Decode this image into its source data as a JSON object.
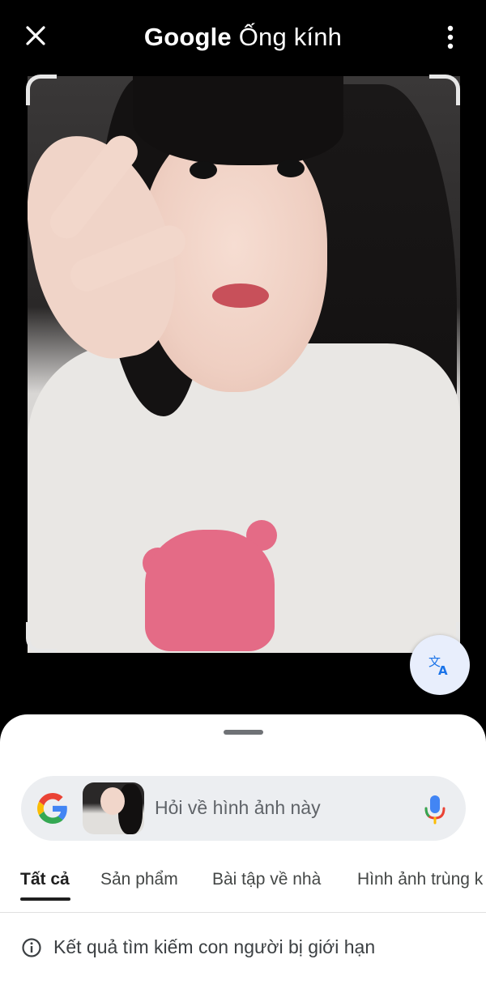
{
  "header": {
    "brand": "Google",
    "product": "Ống kính",
    "close_icon": "close-icon",
    "more_icon": "more-vert-icon"
  },
  "image": {
    "description_icon": "selected-image",
    "translate_icon": "translate-icon"
  },
  "search": {
    "placeholder": "Hỏi về hình ảnh này",
    "logo_icon": "google-g-icon",
    "mic_icon": "mic-icon"
  },
  "tabs": [
    {
      "label": "Tất cả",
      "active": true
    },
    {
      "label": "Sản phẩm",
      "active": false
    },
    {
      "label": "Bài tập về nhà",
      "active": false
    },
    {
      "label": "Hình ảnh trùng k",
      "active": false
    }
  ],
  "notice": {
    "icon": "info-icon",
    "text": "Kết quả tìm kiếm con người bị giới hạn"
  },
  "colors": {
    "accent_blue": "#1a73e8",
    "translate_bg": "#e8eefc",
    "sheet_bg": "#ffffff",
    "searchbar_bg": "#eceef1"
  }
}
